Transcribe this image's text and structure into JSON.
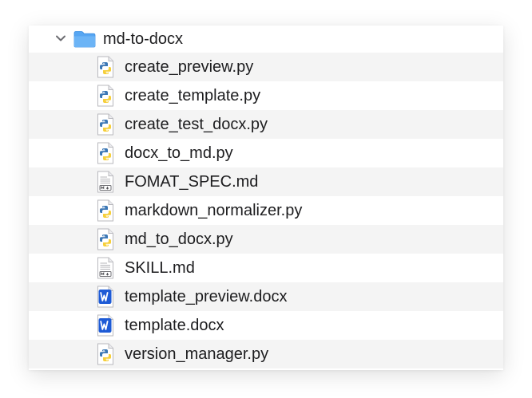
{
  "folder": {
    "name": "md-to-docx",
    "expanded": true,
    "icon": "folder-icon",
    "color": "#3f9bf0"
  },
  "files": [
    {
      "name": "create_preview.py",
      "icon": "python-file-icon"
    },
    {
      "name": "create_template.py",
      "icon": "python-file-icon"
    },
    {
      "name": "create_test_docx.py",
      "icon": "python-file-icon"
    },
    {
      "name": "docx_to_md.py",
      "icon": "python-file-icon"
    },
    {
      "name": "FOMAT_SPEC.md",
      "icon": "markdown-file-icon"
    },
    {
      "name": "markdown_normalizer.py",
      "icon": "python-file-icon"
    },
    {
      "name": "md_to_docx.py",
      "icon": "python-file-icon"
    },
    {
      "name": "SKILL.md",
      "icon": "markdown-file-icon"
    },
    {
      "name": "template_preview.docx",
      "icon": "word-file-icon"
    },
    {
      "name": "template.docx",
      "icon": "word-file-icon"
    },
    {
      "name": "version_manager.py",
      "icon": "python-file-icon"
    }
  ],
  "colors": {
    "row_alt": "#f4f4f4",
    "word_blue": "#1e5bd6",
    "python_blue": "#3b77b5",
    "python_yellow": "#f6cf3b"
  }
}
